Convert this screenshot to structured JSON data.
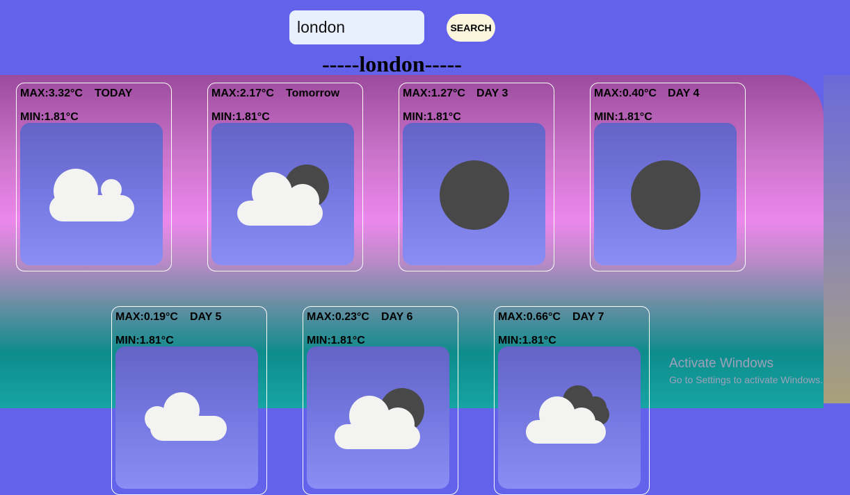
{
  "search": {
    "value": "london",
    "button_label": "SEARCH"
  },
  "city_heading": "-----london-----",
  "forecast": [
    {
      "max": "MAX:3.32°C",
      "day": "TODAY",
      "min": "MIN:1.81°C",
      "icon": "cloud-icon"
    },
    {
      "max": "MAX:2.17°C",
      "day": "Tomorrow",
      "min": "MIN:1.81°C",
      "icon": "cloud-moon-icon"
    },
    {
      "max": "MAX:1.27°C",
      "day": "DAY 3",
      "min": "MIN:1.81°C",
      "icon": "moon-icon"
    },
    {
      "max": "MAX:0.40°C",
      "day": "DAY 4",
      "min": "MIN:1.81°C",
      "icon": "moon-icon"
    },
    {
      "max": "MAX:0.19°C",
      "day": "DAY 5",
      "min": "MIN:1.81°C",
      "icon": "cloud-icon"
    },
    {
      "max": "MAX:0.23°C",
      "day": "DAY 6",
      "min": "MIN:1.81°C",
      "icon": "cloud-moon-icon"
    },
    {
      "max": "MAX:0.66°C",
      "day": "DAY 7",
      "min": "MIN:1.81°C",
      "icon": "cloud-dark-cloud-icon"
    }
  ],
  "watermark": {
    "title": "Activate Windows",
    "subtitle": "Go to Settings to activate Windows."
  },
  "colors": {
    "background": "#6262ea",
    "panel_top": "#9b4a9c",
    "panel_mid": "#ec88ec",
    "panel_bottom": "#16a4a4",
    "card_border": "#ffffff",
    "icon_box": "#7478e0",
    "button": "#fbf6dd",
    "input": "#e8f0fe",
    "cloud": "#f3f3f1",
    "moon": "#484848"
  }
}
